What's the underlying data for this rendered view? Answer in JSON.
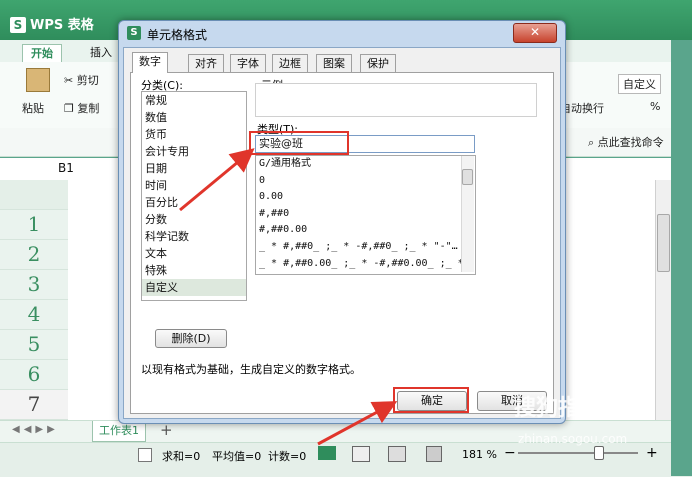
{
  "wps": {
    "app_title": "WPS 表格",
    "tabs": [
      "开始",
      "插入"
    ],
    "ribbon": {
      "paste": "粘贴",
      "cut": "剪切",
      "copy": "复制",
      "wrap": "自动换行",
      "custom": "自定义",
      "percent": "%",
      "find": "点此查找命令"
    },
    "cell_ref": "B1",
    "row_numbers": [
      "1",
      "2",
      "3",
      "4",
      "5",
      "6",
      "7"
    ],
    "sheet_tab": "工作表1",
    "add_sheet": "+",
    "status": {
      "sum": "求和=0",
      "avg": "平均值=0",
      "count": "计数=0",
      "zoom": "181 %",
      "minus": "−",
      "plus": "+"
    }
  },
  "dialog": {
    "title": "单元格格式",
    "close_label": "✕",
    "tabs": [
      "数字",
      "对齐",
      "字体",
      "边框",
      "图案",
      "保护"
    ],
    "category_label": "分类(C):",
    "categories": [
      "常规",
      "数值",
      "货币",
      "会计专用",
      "日期",
      "时间",
      "百分比",
      "分数",
      "科学记数",
      "文本",
      "特殊",
      "自定义"
    ],
    "selected_category": "自定义",
    "sample_label": "示例",
    "type_label": "类型(T):",
    "type_value": "实验@班",
    "formats": [
      "G/通用格式",
      "0",
      "0.00",
      "#,##0",
      "#,##0.00",
      "_ * #,##0_ ;_ * -#,##0_ ;_ * \"-\"…",
      "_ * #,##0.00_ ;_ * -#,##0.00_ ;_ *…"
    ],
    "delete_button": "删除(D)",
    "description": "以现有格式为基础，生成自定义的数字格式。",
    "ok_button": "确定",
    "cancel_button": "取消"
  },
  "watermark": {
    "brand": "搜狗指南",
    "url": "zhinan.sogou.com"
  },
  "colors": {
    "wps_green": "#2f8d5c",
    "highlight_red": "#e0352b",
    "dialog_frame": "#c6d9ee"
  }
}
